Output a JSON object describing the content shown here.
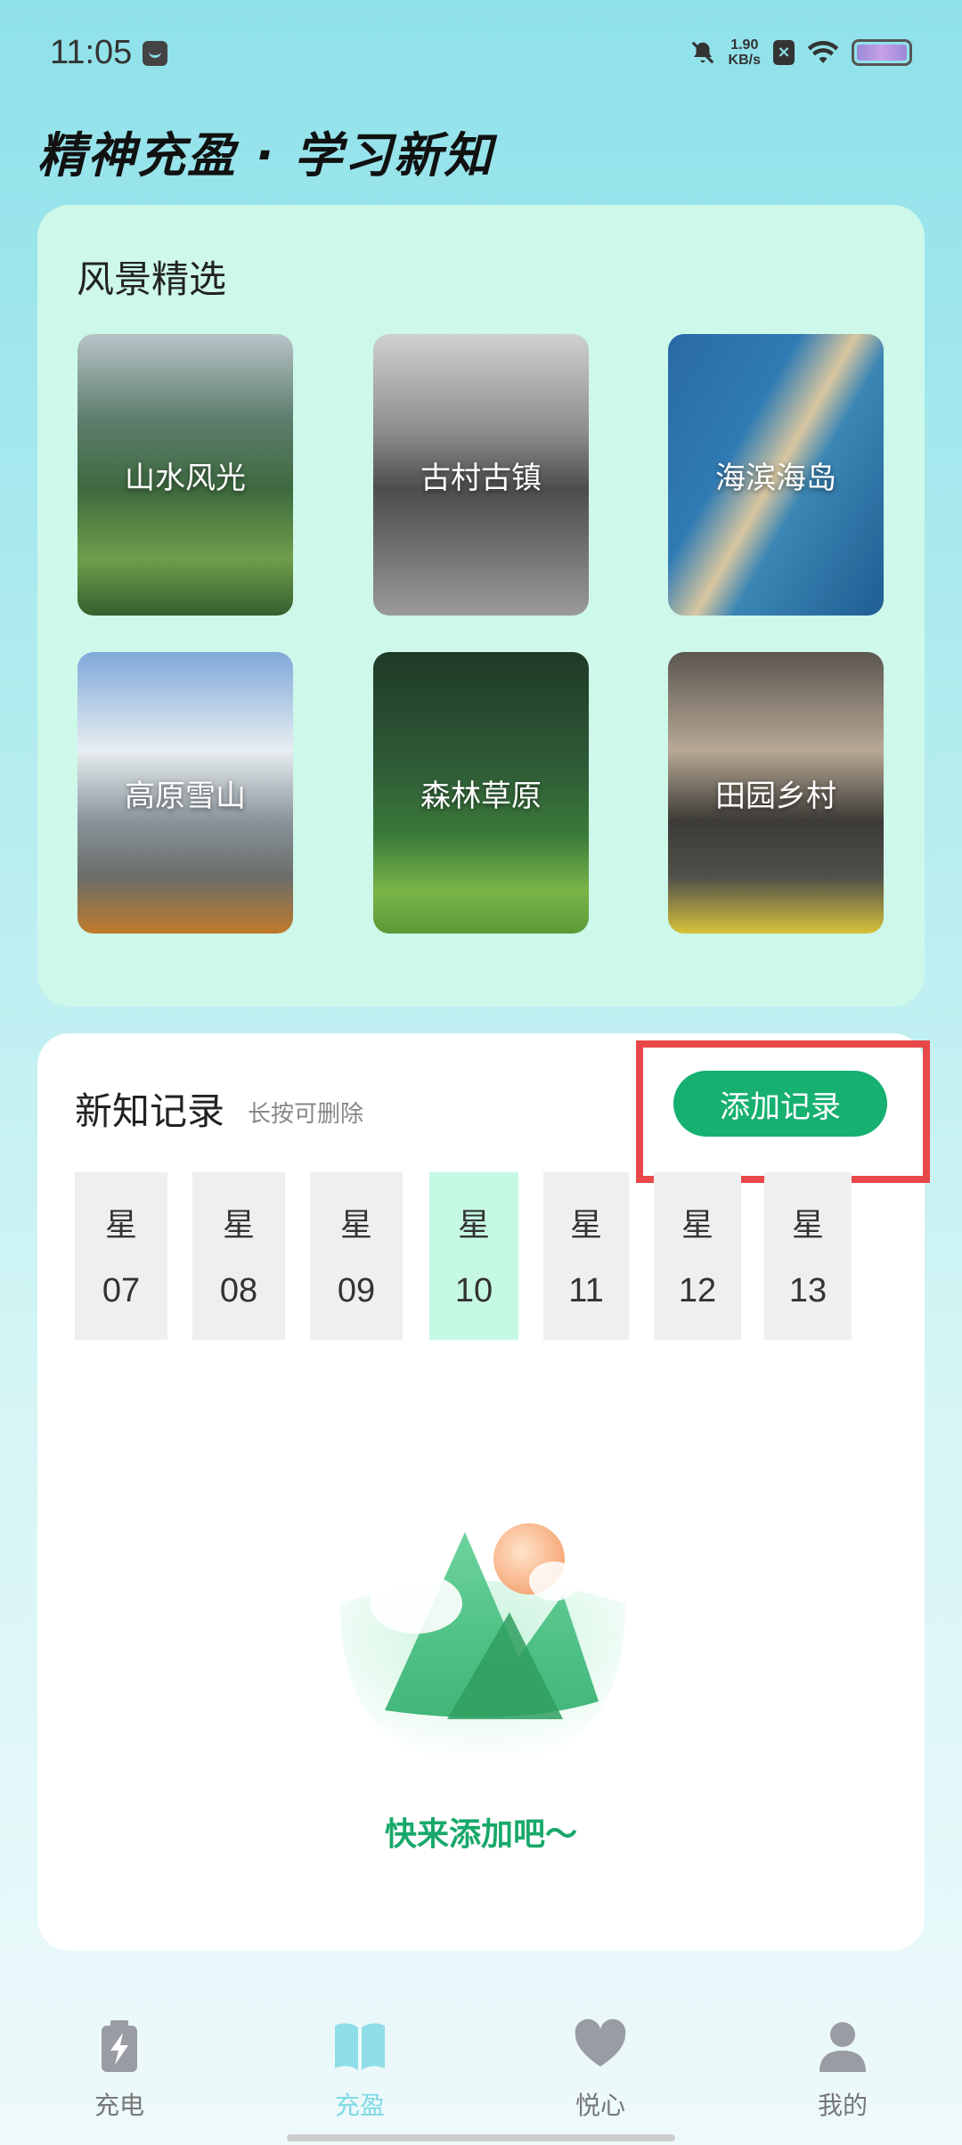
{
  "status_bar": {
    "time": "11:05",
    "net_speed_value": "1.90",
    "net_speed_unit": "KB/s",
    "icons": [
      "app-notification-icon",
      "mute-bell-icon",
      "no-sim-icon",
      "wifi-icon",
      "battery-icon"
    ]
  },
  "header": {
    "slogan": "精神充盈 · 学习新知"
  },
  "scenery": {
    "title": "风景精选",
    "tiles": [
      {
        "label": "山水风光"
      },
      {
        "label": "古村古镇"
      },
      {
        "label": "海滨海岛"
      },
      {
        "label": "高原雪山"
      },
      {
        "label": "森林草原"
      },
      {
        "label": "田园乡村"
      }
    ]
  },
  "records": {
    "title": "新知记录",
    "hint": "长按可删除",
    "add_button_label": "添加记录",
    "days": [
      {
        "week": "星",
        "num": "07"
      },
      {
        "week": "星",
        "num": "08"
      },
      {
        "week": "星",
        "num": "09"
      },
      {
        "week": "星",
        "num": "10",
        "selected": true
      },
      {
        "week": "星",
        "num": "11"
      },
      {
        "week": "星",
        "num": "12"
      },
      {
        "week": "星",
        "num": "13"
      }
    ],
    "empty_text": "快来添加吧～"
  },
  "nav": {
    "items": [
      {
        "label": "充电",
        "icon": "battery-bolt-icon"
      },
      {
        "label": "充盈",
        "icon": "open-book-icon",
        "active": true
      },
      {
        "label": "悦心",
        "icon": "heart-icon"
      },
      {
        "label": "我的",
        "icon": "user-icon"
      }
    ]
  },
  "colors": {
    "accent": "#16b070",
    "highlight": "#e8484a",
    "nav_active": "#7fd9e3"
  }
}
